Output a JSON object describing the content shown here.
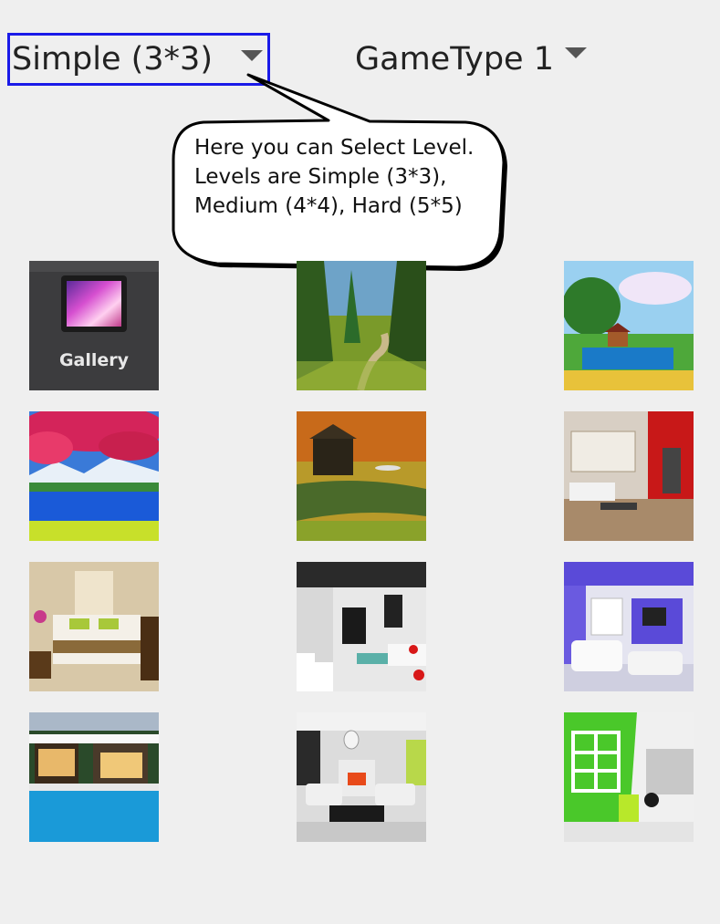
{
  "level_spinner": {
    "selected": "Simple (3*3)"
  },
  "gametype_spinner": {
    "selected": "GameType 1"
  },
  "tooltip": {
    "lines": [
      "Here you can Select Level.",
      "Levels are Simple (3*3),",
      "Medium (4*4), Hard (5*5)"
    ]
  },
  "gallery": {
    "label": "Gallery"
  },
  "thumbnails": [
    {
      "id": "gallery",
      "kind": "gallery-button"
    },
    {
      "id": "forest-path",
      "kind": "photo"
    },
    {
      "id": "lake-cabin-painting",
      "kind": "photo"
    },
    {
      "id": "cherry-blossom-lake",
      "kind": "photo"
    },
    {
      "id": "autumn-river-house",
      "kind": "photo"
    },
    {
      "id": "red-living-room",
      "kind": "photo"
    },
    {
      "id": "bedroom",
      "kind": "photo"
    },
    {
      "id": "modern-staircase-lounge",
      "kind": "photo"
    },
    {
      "id": "purple-living-room",
      "kind": "photo"
    },
    {
      "id": "pool-house",
      "kind": "photo"
    },
    {
      "id": "lounge-with-fireplace",
      "kind": "photo"
    },
    {
      "id": "green-wall-room",
      "kind": "photo"
    }
  ],
  "colors": {
    "selection_border": "#1a1ae8",
    "background": "#efefef"
  }
}
